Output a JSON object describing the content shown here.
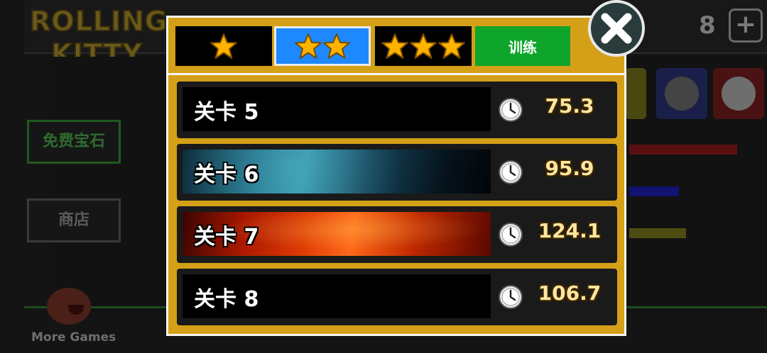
{
  "background": {
    "logo_line1": "ROLLING",
    "logo_line2": "KITTY",
    "gem_count": "8",
    "plus_label": "+",
    "free_gems_label": "免费宝石",
    "shop_label": "商店",
    "more_games_label": "More Games"
  },
  "modal": {
    "tabs": [
      {
        "stars": 1,
        "label": "",
        "selected": false,
        "color": "#000000"
      },
      {
        "stars": 2,
        "label": "",
        "selected": true,
        "color": "#1e88ff"
      },
      {
        "stars": 3,
        "label": "",
        "selected": false,
        "color": "#000000"
      },
      {
        "stars": 0,
        "label": "训练",
        "selected": false,
        "color": "#0fa52a"
      }
    ],
    "close_icon": "close-x-icon",
    "levels": [
      {
        "name": "关卡 5",
        "time": "75.3",
        "theme": "black"
      },
      {
        "name": "关卡 6",
        "time": "95.9",
        "theme": "space-blue"
      },
      {
        "name": "关卡 7",
        "time": "124.1",
        "theme": "space-red"
      },
      {
        "name": "关卡 8",
        "time": "106.7",
        "theme": "black"
      }
    ]
  },
  "colors": {
    "modal_frame": "#d4a017",
    "star": "#ffb300",
    "time_text": "#ffe6a0"
  }
}
